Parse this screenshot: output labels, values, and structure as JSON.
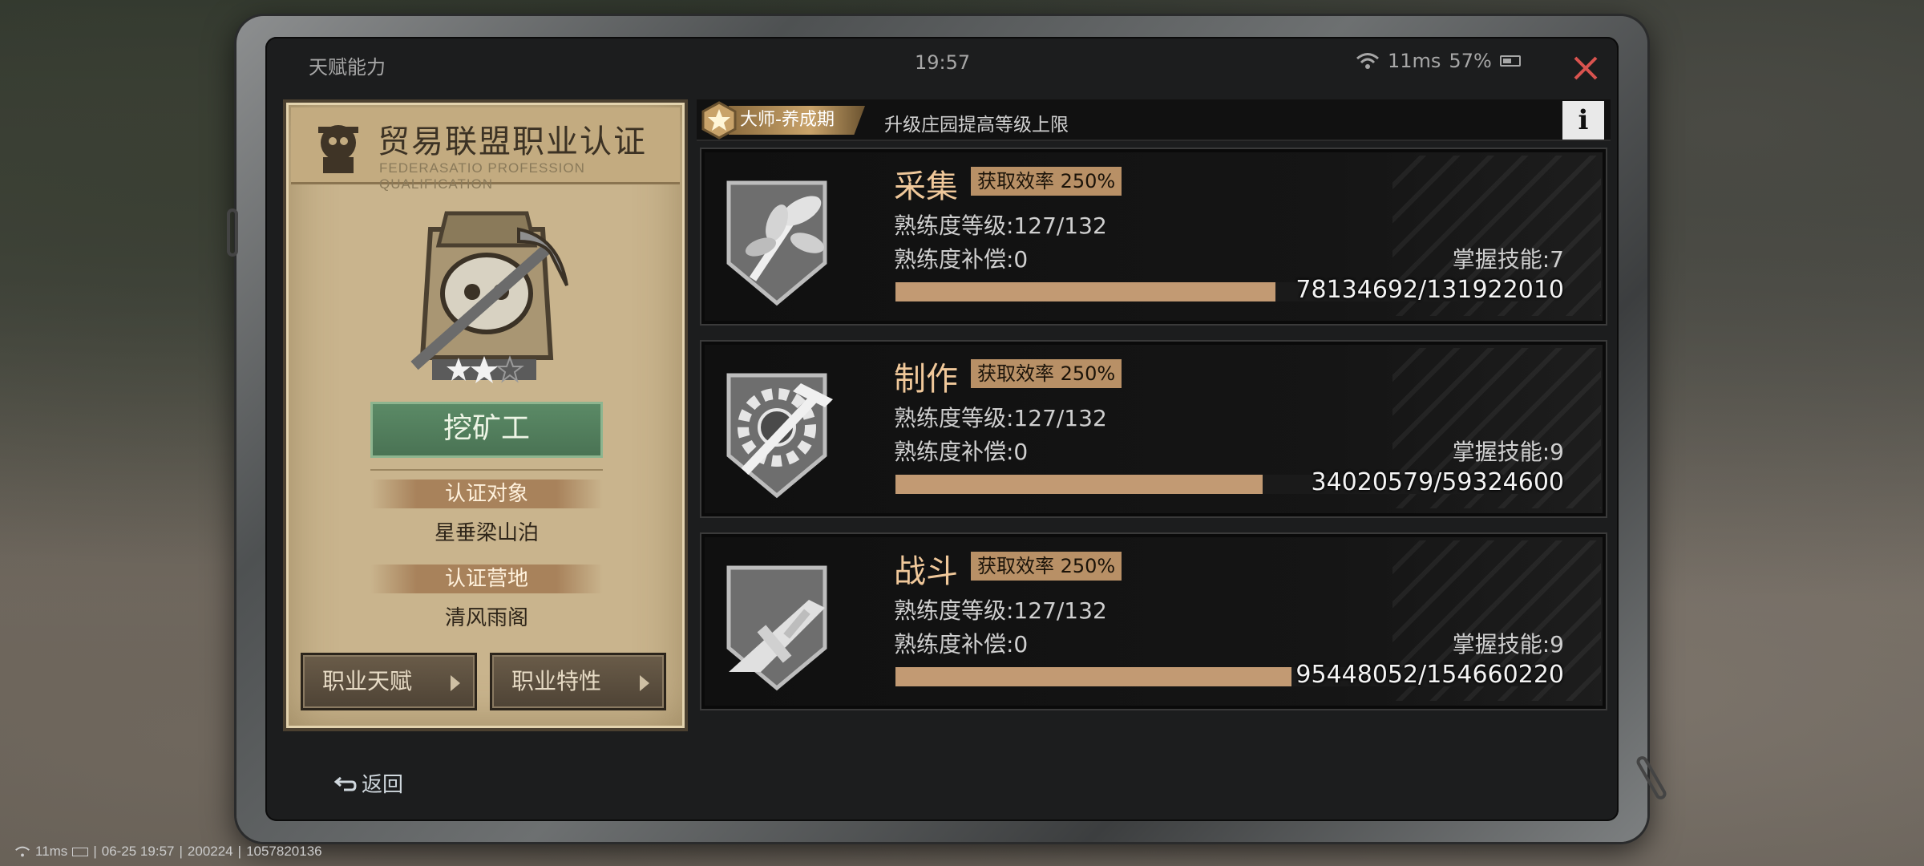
{
  "statusbar": {
    "title": "天赋能力",
    "time": "19:57",
    "ping": "11ms",
    "battery": "57%"
  },
  "card": {
    "title": "贸易联盟职业认证",
    "subtitle": "FEDERASATIO PROFESSION QUALIFICATION",
    "star_rating": {
      "filled": 2,
      "total": 3
    },
    "job": "挖矿工",
    "label1": "认证对象",
    "value1": "星垂梁山泊",
    "label2": "认证营地",
    "value2": "清风雨阁",
    "btn_talent": "职业天赋",
    "btn_trait": "职业特性"
  },
  "rank": {
    "tag": "大师-养成期",
    "desc": "升级庄园提高等级上限",
    "info": "i"
  },
  "skills": [
    {
      "name": "采集",
      "rate": "获取效率 250%",
      "level": "熟练度等级:127/132",
      "comp": "熟练度补偿:0",
      "mastery": "掌握技能:7",
      "progress": "78134692/131922010",
      "fill": 0.592,
      "icon": "plant-bundle-icon"
    },
    {
      "name": "制作",
      "rate": "获取效率 250%",
      "level": "熟练度等级:127/132",
      "comp": "熟练度补偿:0",
      "mastery": "掌握技能:9",
      "progress": "34020579/59324600",
      "fill": 0.573,
      "icon": "gear-hammer-icon"
    },
    {
      "name": "战斗",
      "rate": "获取效率 250%",
      "level": "熟练度等级:127/132",
      "comp": "熟练度补偿:0",
      "mastery": "掌握技能:9",
      "progress": "95448052/154660220",
      "fill": 0.617,
      "icon": "submachine-gun-icon"
    }
  ],
  "back": "返回",
  "bottom": {
    "ping": "11ms",
    "datetime": "06-25 19:57",
    "code1": "200224",
    "code2": "1057820136"
  },
  "colors": {
    "accent": "#c29a73",
    "job_green": "#4a7354",
    "close_red": "#d9534f"
  }
}
